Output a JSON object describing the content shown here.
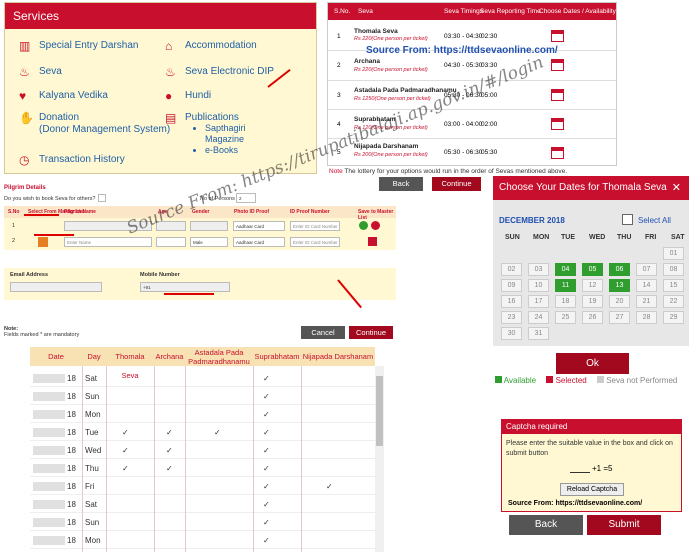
{
  "services": {
    "title": "Services",
    "items": [
      {
        "label": "Special Entry Darshan",
        "icon": "ticket-icon"
      },
      {
        "label": "Accommodation",
        "icon": "building-icon"
      },
      {
        "label": "Seva",
        "icon": "lamp-icon"
      },
      {
        "label": "Seva Electronic DIP",
        "icon": "lamp-icon"
      },
      {
        "label": "Kalyana Vedika",
        "icon": "wedding-icon"
      },
      {
        "label": "Hundi",
        "icon": "pot-icon"
      },
      {
        "label": "Donation",
        "sub": "(Donor Management System)",
        "icon": "donation-icon"
      },
      {
        "label": "Publications",
        "icon": "book-icon",
        "list": [
          "Sapthagiri Magazine",
          "e-Books"
        ]
      },
      {
        "label": "Transaction History",
        "icon": "history-icon"
      }
    ]
  },
  "seva_table": {
    "headers": [
      "S.No.",
      "Seva",
      "Seva Timings",
      "Seva Reporting Time",
      "Choose Dates / Availability"
    ],
    "rows": [
      {
        "no": "1",
        "name": "Thomala Seva",
        "price": "Rs 220(One person per ticket)",
        "timing": "03:30 - 04:30",
        "report": "02:30"
      },
      {
        "no": "2",
        "name": "Archana",
        "price": "Rs 220(One person per ticket)",
        "timing": "04:30 - 05:30",
        "report": "03:30"
      },
      {
        "no": "3",
        "name": "Astadala Pada Padmaradhanamu",
        "price": "Rs 1250(One person per ticket)",
        "timing": "05:30 - 06:30",
        "report": "05:00"
      },
      {
        "no": "4",
        "name": "Suprabhatam",
        "price": "Rs 120(One person per ticket)",
        "timing": "03:00 - 04:00",
        "report": "02:00"
      },
      {
        "no": "5",
        "name": "Nijapada Darshanam",
        "price": "Rs 200(One person per ticket)",
        "timing": "05:30 - 06:30",
        "report": "05:30"
      }
    ],
    "source": "Source From: https://ttdsevaonline.com/",
    "note_label": "Note",
    "note": "The lottery for your options would run in the order of Sevas mentioned above.",
    "back": "Back",
    "continue": "Continue"
  },
  "pilgrim": {
    "title": "Pilgrim Details",
    "question": "Do you wish to book Seva for others?",
    "persons_label": "No of Persons",
    "persons_value": "2",
    "cols": [
      "S.No",
      "Select From Master List",
      "Pilgrim Name",
      "Age",
      "Gender",
      "Photo ID Proof",
      "ID Proof Number",
      "Save to Master List"
    ],
    "rows": [
      {
        "no": "1",
        "photo": "Aadhaar Card",
        "id": "Enter ID Card Number"
      },
      {
        "no": "2",
        "name_ph": "Enter Name",
        "gender": "Male",
        "photo": "Aadhaar Card",
        "id": "Enter ID Card Number"
      }
    ],
    "email_label": "Email Address",
    "mobile_label": "Mobile Number",
    "mobile_code": "+91",
    "note_title": "Note:",
    "note": "Fields marked * are mandatory",
    "cancel": "Cancel",
    "continue": "Continue"
  },
  "calendar": {
    "title": "Choose Your Dates for Thomala Seva",
    "month": "DECEMBER 2018",
    "select_all": "Select All",
    "weekdays": [
      "SUN",
      "MON",
      "TUE",
      "WED",
      "THU",
      "FRI",
      "SAT"
    ],
    "days": [
      "01",
      "02",
      "03",
      "04",
      "05",
      "06",
      "07",
      "08",
      "09",
      "10",
      "11",
      "12",
      "13",
      "14",
      "15",
      "16",
      "17",
      "18",
      "19",
      "20",
      "21",
      "22",
      "23",
      "24",
      "25",
      "26",
      "27",
      "28",
      "29",
      "30",
      "31"
    ],
    "available": [
      "04",
      "05",
      "06",
      "11",
      "13"
    ],
    "ok": "Ok",
    "legend": [
      "Available",
      "Selected",
      "Seva not Performed"
    ],
    "colors": {
      "available": "#2f9e2f",
      "selected": "#c8102e",
      "not_performed": "#cccccc"
    }
  },
  "availability": {
    "headers": [
      "Date",
      "Day",
      "Thomala Seva",
      "Archana",
      "Astadala Pada Padmaradhanamu",
      "Suprabhatam",
      "Nijapada Darshanam"
    ],
    "rows": [
      {
        "yr": "18",
        "day": "Sat",
        "checks": [
          0,
          0,
          0,
          1,
          0
        ]
      },
      {
        "yr": "18",
        "day": "Sun",
        "checks": [
          0,
          0,
          0,
          1,
          0
        ]
      },
      {
        "yr": "18",
        "day": "Mon",
        "checks": [
          0,
          0,
          0,
          1,
          0
        ]
      },
      {
        "yr": "18",
        "day": "Tue",
        "checks": [
          1,
          1,
          1,
          1,
          0
        ]
      },
      {
        "yr": "18",
        "day": "Wed",
        "checks": [
          1,
          1,
          0,
          1,
          0
        ]
      },
      {
        "yr": "18",
        "day": "Thu",
        "checks": [
          1,
          1,
          0,
          1,
          0
        ]
      },
      {
        "yr": "18",
        "day": "Fri",
        "checks": [
          0,
          0,
          0,
          1,
          1
        ]
      },
      {
        "yr": "18",
        "day": "Sat",
        "checks": [
          0,
          0,
          0,
          1,
          0
        ]
      },
      {
        "yr": "18",
        "day": "Sun",
        "checks": [
          0,
          0,
          0,
          1,
          0
        ]
      },
      {
        "yr": "18",
        "day": "Mon",
        "checks": [
          0,
          0,
          0,
          1,
          0
        ]
      }
    ]
  },
  "captcha": {
    "title": "Captcha required",
    "text": "Please enter the suitable value in the box and click on submit button",
    "equation": "+1 =5",
    "reload": "Reload Captcha",
    "source": "Source From: https://ttdsevaonline.com/",
    "back": "Back",
    "submit": "Submit"
  },
  "watermark": "Source From: https://tirupatibalaji.ap.gov.in/#/login"
}
